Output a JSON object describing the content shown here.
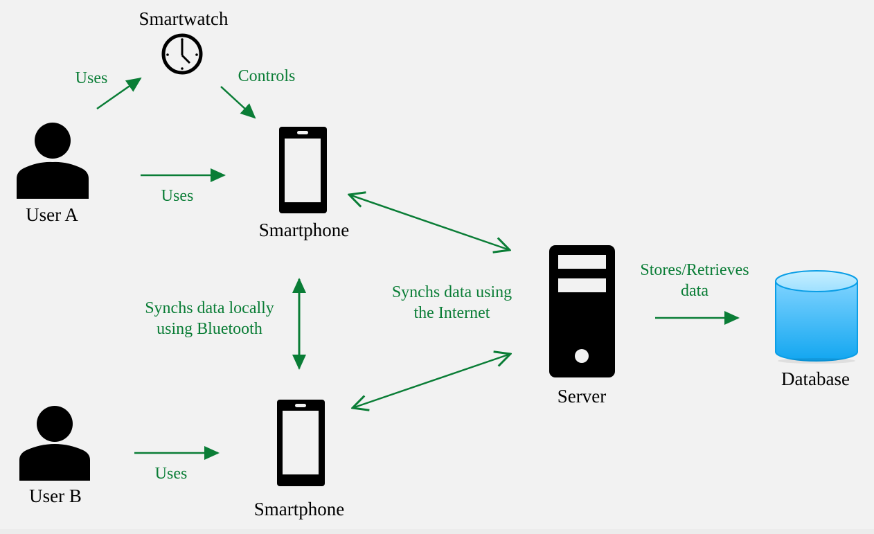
{
  "colors": {
    "background": "#f2f2f2",
    "arrow": "#0a7d36",
    "label_green": "#0a7d36",
    "icon": "#000000",
    "database_top": "#aee6ff",
    "database_body": "#1aa9f0"
  },
  "nodes": {
    "smartwatch": {
      "label": "Smartwatch",
      "icon": "clock-icon"
    },
    "user_a": {
      "label": "User A",
      "icon": "user-icon"
    },
    "user_b": {
      "label": "User B",
      "icon": "user-icon"
    },
    "smartphone_a": {
      "label": "Smartphone",
      "icon": "smartphone-icon"
    },
    "smartphone_b": {
      "label": "Smartphone",
      "icon": "smartphone-icon"
    },
    "server": {
      "label": "Server",
      "icon": "server-icon"
    },
    "database": {
      "label": "Database",
      "icon": "database-icon"
    }
  },
  "edges": {
    "user_a_smartwatch": {
      "label": "Uses"
    },
    "smartwatch_phone": {
      "label": "Controls"
    },
    "user_a_phone": {
      "label": "Uses"
    },
    "bluetooth": {
      "line1": "Synchs data locally",
      "line2": "using Bluetooth"
    },
    "internet": {
      "line1": "Synchs data using",
      "line2": "the Internet"
    },
    "user_b_phone": {
      "label": "Uses"
    },
    "server_db": {
      "line1": "Stores/Retrieves",
      "line2": "data"
    }
  }
}
